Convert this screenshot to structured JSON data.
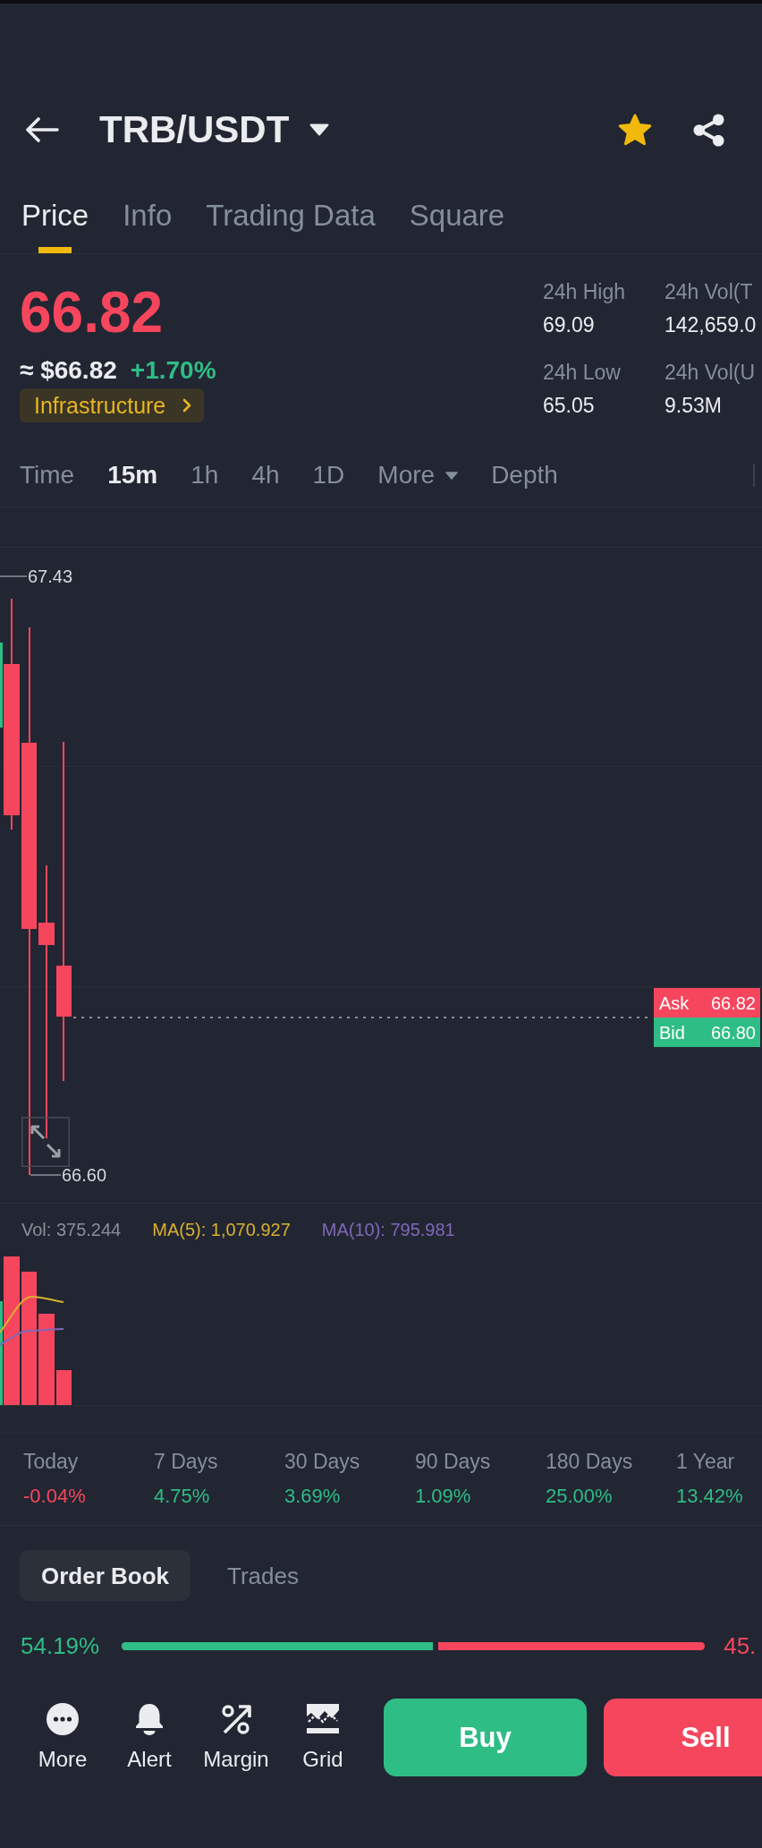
{
  "header": {
    "title": "TRB/USDT",
    "favorite": true
  },
  "tabs": [
    {
      "label": "Price",
      "selected": true
    },
    {
      "label": "Info",
      "selected": false
    },
    {
      "label": "Trading Data",
      "selected": false
    },
    {
      "label": "Square",
      "selected": false
    }
  ],
  "ticker": {
    "price": "66.82",
    "price_rising": false,
    "fiat": "≈ $66.82",
    "change": "+1.70%",
    "change_rising": true,
    "sector": "Infrastructure"
  },
  "stats": [
    {
      "label": "24h High",
      "value": "69.09"
    },
    {
      "label": "24h Vol(T",
      "value": "142,659.0"
    },
    {
      "label": "24h Low",
      "value": "65.05"
    },
    {
      "label": "24h Vol(U",
      "value": "9.53M"
    }
  ],
  "intervals": [
    {
      "label": "Time",
      "kind": "option",
      "selected": false
    },
    {
      "label": "15m",
      "kind": "option",
      "selected": true
    },
    {
      "label": "1h",
      "kind": "option",
      "selected": false
    },
    {
      "label": "4h",
      "kind": "option",
      "selected": false
    },
    {
      "label": "1D",
      "kind": "option",
      "selected": false
    },
    {
      "label": "More",
      "kind": "menu",
      "selected": false
    },
    {
      "label": "Depth",
      "kind": "option",
      "selected": false
    }
  ],
  "chart": {
    "high_label": "67.43",
    "low_label": "66.60",
    "quotes": [
      {
        "label": "Ask",
        "value": "66.82",
        "kind": "ask"
      },
      {
        "label": "Bid",
        "value": "66.80",
        "kind": "bid"
      }
    ]
  },
  "volume": {
    "indicators": [
      {
        "text": "Vol: 375.244",
        "color": "#8a8f9a"
      },
      {
        "text": "MA(5): 1,070.927",
        "color": "#d9b030"
      },
      {
        "text": "MA(10): 795.981",
        "color": "#7e68b8"
      }
    ]
  },
  "performance": [
    {
      "label": "Today",
      "value": "-0.04%",
      "rising": false
    },
    {
      "label": "7 Days",
      "value": "4.75%",
      "rising": true
    },
    {
      "label": "30 Days",
      "value": "3.69%",
      "rising": true
    },
    {
      "label": "90 Days",
      "value": "1.09%",
      "rising": true
    },
    {
      "label": "180 Days",
      "value": "25.00%",
      "rising": true
    },
    {
      "label": "1 Year",
      "value": "13.42%",
      "rising": true
    }
  ],
  "book_tabs": [
    {
      "label": "Order Book",
      "selected": true
    },
    {
      "label": "Trades",
      "selected": false
    }
  ],
  "ratio": {
    "buy": "54.19%",
    "sell": "45.",
    "level": 0.5419
  },
  "actions": [
    {
      "label": "More",
      "kind": "more"
    },
    {
      "label": "Alert",
      "kind": "alert"
    },
    {
      "label": "Margin",
      "kind": "margin"
    },
    {
      "label": "Grid",
      "kind": "grid"
    }
  ],
  "trade_buttons": [
    {
      "label": "Buy",
      "kind": "buy"
    },
    {
      "label": "Sell",
      "kind": "sell"
    }
  ]
}
